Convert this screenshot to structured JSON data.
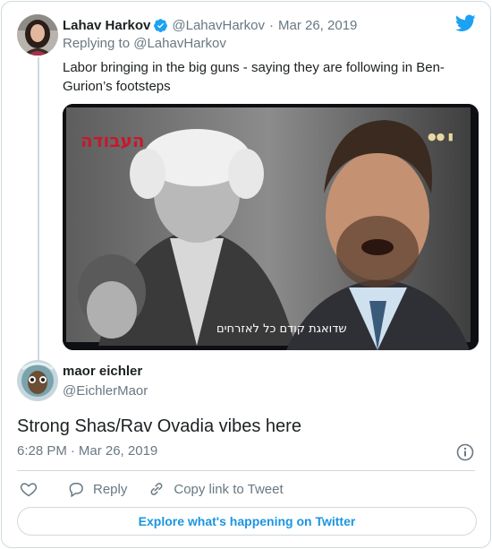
{
  "parent_tweet": {
    "author_name": "Lahav Harkov",
    "author_handle": "@LahavHarkov",
    "separator": "·",
    "date": "Mar 26, 2019",
    "replying_prefix": "Replying to",
    "replying_to": "@LahavHarkov",
    "text": "Labor bringing in the big guns - saying they are following in Ben-Gurion’s footsteps",
    "media": {
      "logo_text": "העבודה",
      "subtitle": "שדואגת קודם כל לאזרחים"
    }
  },
  "reply_tweet": {
    "author_name": "maor eichler",
    "author_handle": "@EichlerMaor",
    "text": "Strong Shas/Rav Ovadia vibes here",
    "time": "6:28 PM",
    "separator": "·",
    "date": "Mar 26, 2019"
  },
  "actions": {
    "reply_label": "Reply",
    "copy_link_label": "Copy link to Tweet"
  },
  "explore_label": "Explore what's happening on Twitter",
  "colors": {
    "twitter_blue": "#1da1f2",
    "link_blue": "#1b95e0",
    "secondary_text": "#697882",
    "border": "#cfd9de"
  },
  "icons": [
    "verified-badge-icon",
    "twitter-bird-icon",
    "info-icon",
    "heart-icon",
    "reply-icon",
    "link-icon"
  ]
}
